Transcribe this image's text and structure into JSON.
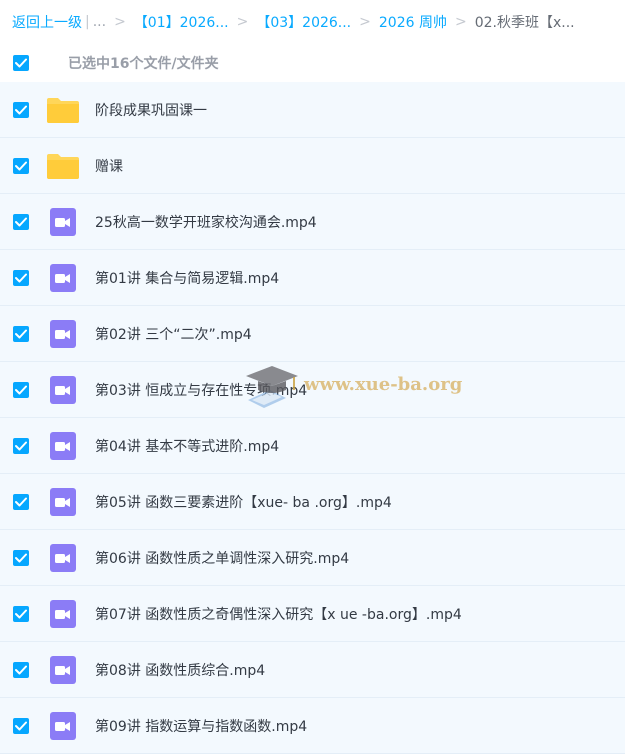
{
  "breadcrumb": {
    "back_label": "返回上一级",
    "ellipsis": "...",
    "crumb1": "【01】2026...",
    "crumb2": "【03】2026...",
    "crumb3": "2026 周帅",
    "current": "02.秋季班【x..."
  },
  "selection": {
    "label": "已选中16个文件/文件夹"
  },
  "files": [
    {
      "name": "阶段成果巩固课一",
      "type": "folder",
      "checked": true
    },
    {
      "name": "赠课",
      "type": "folder",
      "checked": true
    },
    {
      "name": "25秋高一数学开班家校沟通会.mp4",
      "type": "video",
      "checked": true
    },
    {
      "name": "第01讲 集合与简易逻辑.mp4",
      "type": "video",
      "checked": true
    },
    {
      "name": "第02讲 三个“二次”.mp4",
      "type": "video",
      "checked": true
    },
    {
      "name": "第03讲 恒成立与存在性专项.mp4",
      "type": "video",
      "checked": true
    },
    {
      "name": "第04讲 基本不等式进阶.mp4",
      "type": "video",
      "checked": true
    },
    {
      "name": "第05讲 函数三要素进阶【xue- ba .org】.mp4",
      "type": "video",
      "checked": true
    },
    {
      "name": "第06讲 函数性质之单调性深入研究.mp4",
      "type": "video",
      "checked": true
    },
    {
      "name": "第07讲 函数性质之奇偶性深入研究【x ue -ba.org】.mp4",
      "type": "video",
      "checked": true
    },
    {
      "name": "第08讲 函数性质综合.mp4",
      "type": "video",
      "checked": true
    },
    {
      "name": "第09讲 指数运算与指数函数.mp4",
      "type": "video",
      "checked": true
    }
  ],
  "watermark": {
    "text": "www.xue-ba.org"
  },
  "colors": {
    "accent": "#06a7ff",
    "row_bg": "#f3f9fe",
    "folder": "#ffd659",
    "video": "#8b7cf6"
  }
}
